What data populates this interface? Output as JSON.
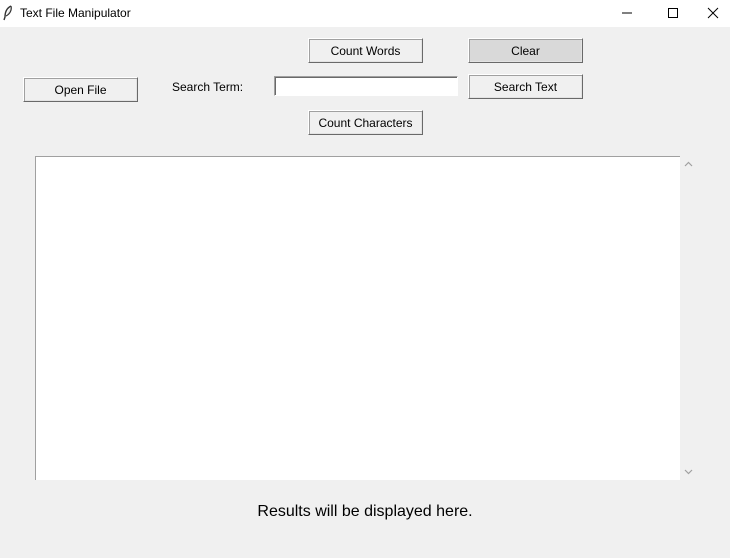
{
  "window": {
    "title": "Text File Manipulator"
  },
  "buttons": {
    "open_file": "Open File",
    "count_words": "Count Words",
    "clear": "Clear",
    "search_text": "Search Text",
    "count_characters": "Count Characters"
  },
  "search": {
    "label": "Search Term:",
    "value": ""
  },
  "editor": {
    "content": ""
  },
  "results": {
    "text": "Results will be displayed here."
  },
  "icons": {
    "app": "feather-icon",
    "minimize": "minimize-icon",
    "maximize": "maximize-icon",
    "close": "close-icon",
    "scroll_up": "chevron-up-icon",
    "scroll_down": "chevron-down-icon"
  }
}
